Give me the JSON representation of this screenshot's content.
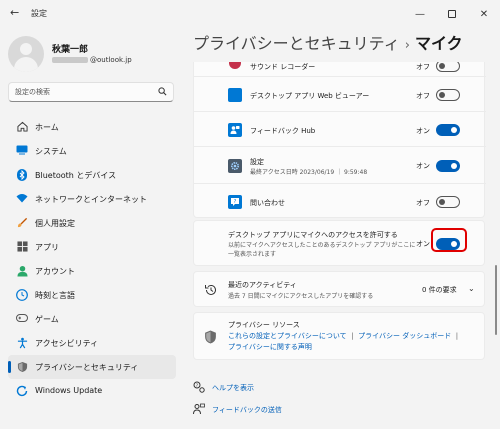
{
  "window": {
    "app_title": "設定",
    "back_icon": "back-arrow-icon",
    "minimize_icon": "minimize-icon",
    "maximize_icon": "maximize-icon",
    "close_icon": "close-icon"
  },
  "profile": {
    "name": "秋葉一郎",
    "email_visible": "@outlook.jp"
  },
  "search": {
    "placeholder": "設定の検索"
  },
  "nav": [
    {
      "label": "ホーム",
      "icon": "home-icon",
      "color": "#333333"
    },
    {
      "label": "システム",
      "icon": "system-icon",
      "color": "#0078d4"
    },
    {
      "label": "Bluetooth とデバイス",
      "icon": "bluetooth-icon",
      "color": "#0078d4"
    },
    {
      "label": "ネットワークとインターネット",
      "icon": "wifi-icon",
      "color": "#0078d4"
    },
    {
      "label": "個人用設定",
      "icon": "brush-icon",
      "color": "#c25400"
    },
    {
      "label": "アプリ",
      "icon": "apps-icon",
      "color": "#555555"
    },
    {
      "label": "アカウント",
      "icon": "account-icon",
      "color": "#2ba86a"
    },
    {
      "label": "時刻と言語",
      "icon": "time-language-icon",
      "color": "#0078d4"
    },
    {
      "label": "ゲーム",
      "icon": "game-icon",
      "color": "#555555"
    },
    {
      "label": "アクセシビリティ",
      "icon": "accessibility-icon",
      "color": "#0078d4"
    },
    {
      "label": "プライバシーとセキュリティ",
      "icon": "shield-icon",
      "color": "#666666",
      "active": true
    },
    {
      "label": "Windows Update",
      "icon": "windows-update-icon",
      "color": "#0078d4"
    }
  ],
  "header": {
    "breadcrumb": "プライバシーとセキュリティ",
    "separator": "›",
    "current": "マイク"
  },
  "apps": [
    {
      "name": "サウンド レコーダー",
      "state": "オフ",
      "on": false,
      "icon": "sound-recorder-icon",
      "color": "#c4314b"
    },
    {
      "name": "デスクトップ アプリ Web ビューアー",
      "state": "オフ",
      "on": false,
      "icon": "webview-icon",
      "color": "#0078d4"
    },
    {
      "name": "フィードバック Hub",
      "state": "オン",
      "on": true,
      "icon": "feedback-hub-icon",
      "color": "#0078d4"
    },
    {
      "name": "設定",
      "sub": "最終アクセス日時 2023/06/19 ｜ 9:59:48",
      "state": "オン",
      "on": true,
      "icon": "settings-gear-icon",
      "color": "#4a5a6a"
    },
    {
      "name": "問い合わせ",
      "state": "オフ",
      "on": false,
      "icon": "get-help-icon",
      "color": "#0078d4"
    }
  ],
  "desktop_access": {
    "title": "デスクトップ アプリにマイクへのアクセスを許可する",
    "desc1": "以前にマイクへアクセスしたことのあるデスクトップ アプリがここに",
    "desc2": "一覧表示されます",
    "state": "オン",
    "on": true
  },
  "recent": {
    "title": "最近のアクティビティ",
    "sub": "過去 7 日間にマイクにアクセスしたアプリを確認する",
    "requests": "0 件の要求",
    "icon": "history-icon"
  },
  "resources": {
    "title": "プライバシー リソース",
    "links": [
      "これらの設定とプライバシーについて",
      "プライバシー ダッシュボード",
      "プライバシーに関する声明"
    ],
    "divider": "|",
    "icon": "shield-icon"
  },
  "help": {
    "get_help": "ヘルプを表示",
    "feedback": "フィードバックの送信"
  }
}
